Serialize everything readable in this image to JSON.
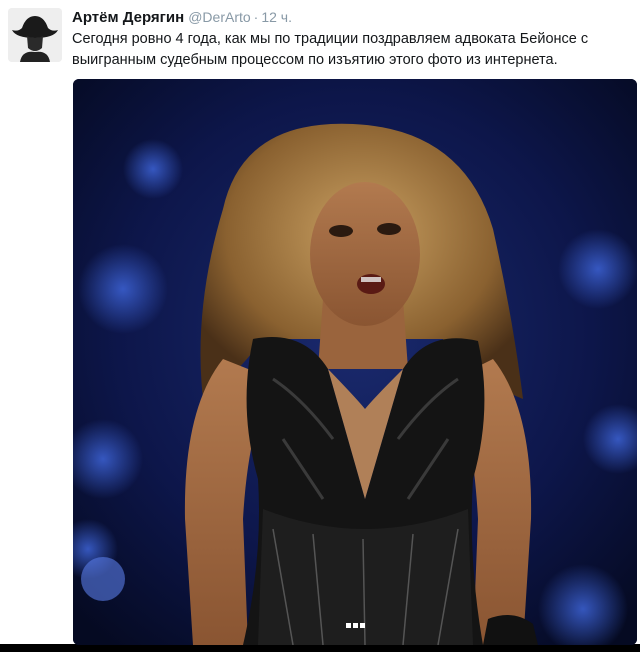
{
  "tweet": {
    "author_name": "Артём Дерягин",
    "author_handle": "@DerArto",
    "separator": "·",
    "time": "12 ч.",
    "text": "Сегодня ровно 4 года, как мы по традиции поздравляем адвоката Бейонсе с выигранным судебным процессом по изъятию этого фото из интернета.",
    "avatar": "avatar-icon",
    "media": {
      "description_icon": "photo-image",
      "pager_count": 3
    }
  },
  "colors": {
    "name": "#14171a",
    "meta": "#8899a6",
    "background": "#ffffff",
    "frame": "#000000"
  }
}
